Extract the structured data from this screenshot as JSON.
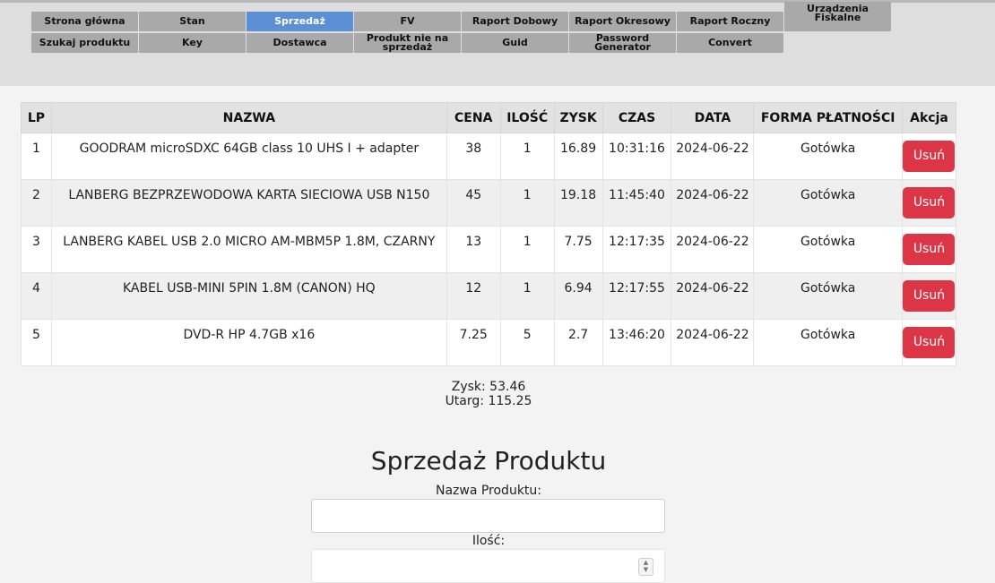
{
  "nav": {
    "row1": [
      "Strona główna",
      "Stan",
      "Sprzedaż",
      "FV",
      "Raport Dobowy",
      "Raport Okresowy",
      "Raport Roczny",
      "Urządzenia Fiskalne"
    ],
    "row2": [
      "Szukaj produktu",
      "Key",
      "Dostawca",
      "Produkt nie na sprzedaż",
      "Guid",
      "Password Generator",
      "Convert"
    ],
    "active": "Sprzedaż"
  },
  "table": {
    "headers": {
      "lp": "LP",
      "nazwa": "NAZWA",
      "cena": "CENA",
      "ilosc": "ILOŚĆ",
      "zysk": "ZYSK",
      "czas": "CZAS",
      "data": "DATA",
      "forma": "FORMA PŁATNOŚCI",
      "akcja": "Akcja"
    },
    "delete_label": "Usuń",
    "rows": [
      {
        "lp": "1",
        "nazwa": "GOODRAM microSDXC 64GB class 10 UHS I + adapter",
        "cena": "38",
        "ilosc": "1",
        "zysk": "16.89",
        "czas": "10:31:16",
        "data": "2024-06-22",
        "forma": "Gotówka"
      },
      {
        "lp": "2",
        "nazwa": "LANBERG BEZPRZEWODOWA KARTA SIECIOWA USB N150",
        "cena": "45",
        "ilosc": "1",
        "zysk": "19.18",
        "czas": "11:45:40",
        "data": "2024-06-22",
        "forma": "Gotówka"
      },
      {
        "lp": "3",
        "nazwa": "LANBERG KABEL USB 2.0 MICRO AM-MBM5P 1.8M, CZARNY",
        "cena": "13",
        "ilosc": "1",
        "zysk": "7.75",
        "czas": "12:17:35",
        "data": "2024-06-22",
        "forma": "Gotówka"
      },
      {
        "lp": "4",
        "nazwa": "KABEL USB-MINI 5PIN 1.8M (CANON) HQ",
        "cena": "12",
        "ilosc": "1",
        "zysk": "6.94",
        "czas": "12:17:55",
        "data": "2024-06-22",
        "forma": "Gotówka"
      },
      {
        "lp": "5",
        "nazwa": "DVD-R HP 4.7GB x16",
        "cena": "7.25",
        "ilosc": "5",
        "zysk": "2.7",
        "czas": "13:46:20",
        "data": "2024-06-22",
        "forma": "Gotówka"
      }
    ]
  },
  "summary": {
    "zysk": "Zysk: 53.46",
    "utarg": "Utarg: 115.25"
  },
  "form": {
    "title": "Sprzedaż Produktu",
    "name_label": "Nazwa Produktu:",
    "name_value": "",
    "qty_label": "Ilość:",
    "qty_value": ""
  },
  "colors": {
    "nav_bg": "#a9a9a9",
    "nav_active": "#5b8fd6",
    "delete_btn": "#dc3545"
  }
}
